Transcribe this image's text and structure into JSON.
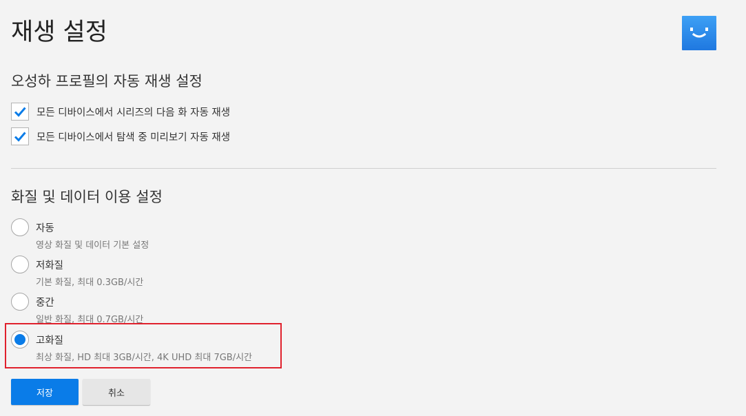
{
  "page": {
    "title": "재생 설정"
  },
  "avatar": {
    "icon": "smiley-face-icon",
    "color": "#2a8ae8"
  },
  "autoplay": {
    "title": "오성하 프로필의 자동 재생 설정",
    "options": [
      {
        "label": "모든 디바이스에서 시리즈의 다음 화 자동 재생",
        "checked": true
      },
      {
        "label": "모든 디바이스에서 탐색 중 미리보기 자동 재생",
        "checked": true
      }
    ]
  },
  "quality": {
    "title": "화질 및 데이터 이용 설정",
    "selected": "고화질",
    "options": [
      {
        "label": "자동",
        "description": "영상 화질 및 데이터 기본 설정",
        "selected": false
      },
      {
        "label": "저화질",
        "description": "기본 화질, 최대 0.3GB/시간",
        "selected": false
      },
      {
        "label": "중간",
        "description": "일반 화질, 최대 0.7GB/시간",
        "selected": false
      },
      {
        "label": "고화질",
        "description": "최상 화질, HD 최대 3GB/시간, 4K UHD 최대 7GB/시간",
        "selected": true
      }
    ]
  },
  "actions": {
    "save_label": "저장",
    "cancel_label": "취소"
  },
  "colors": {
    "accent": "#0a7ce8",
    "highlight": "#e0202c",
    "background": "#f3f3f3"
  }
}
